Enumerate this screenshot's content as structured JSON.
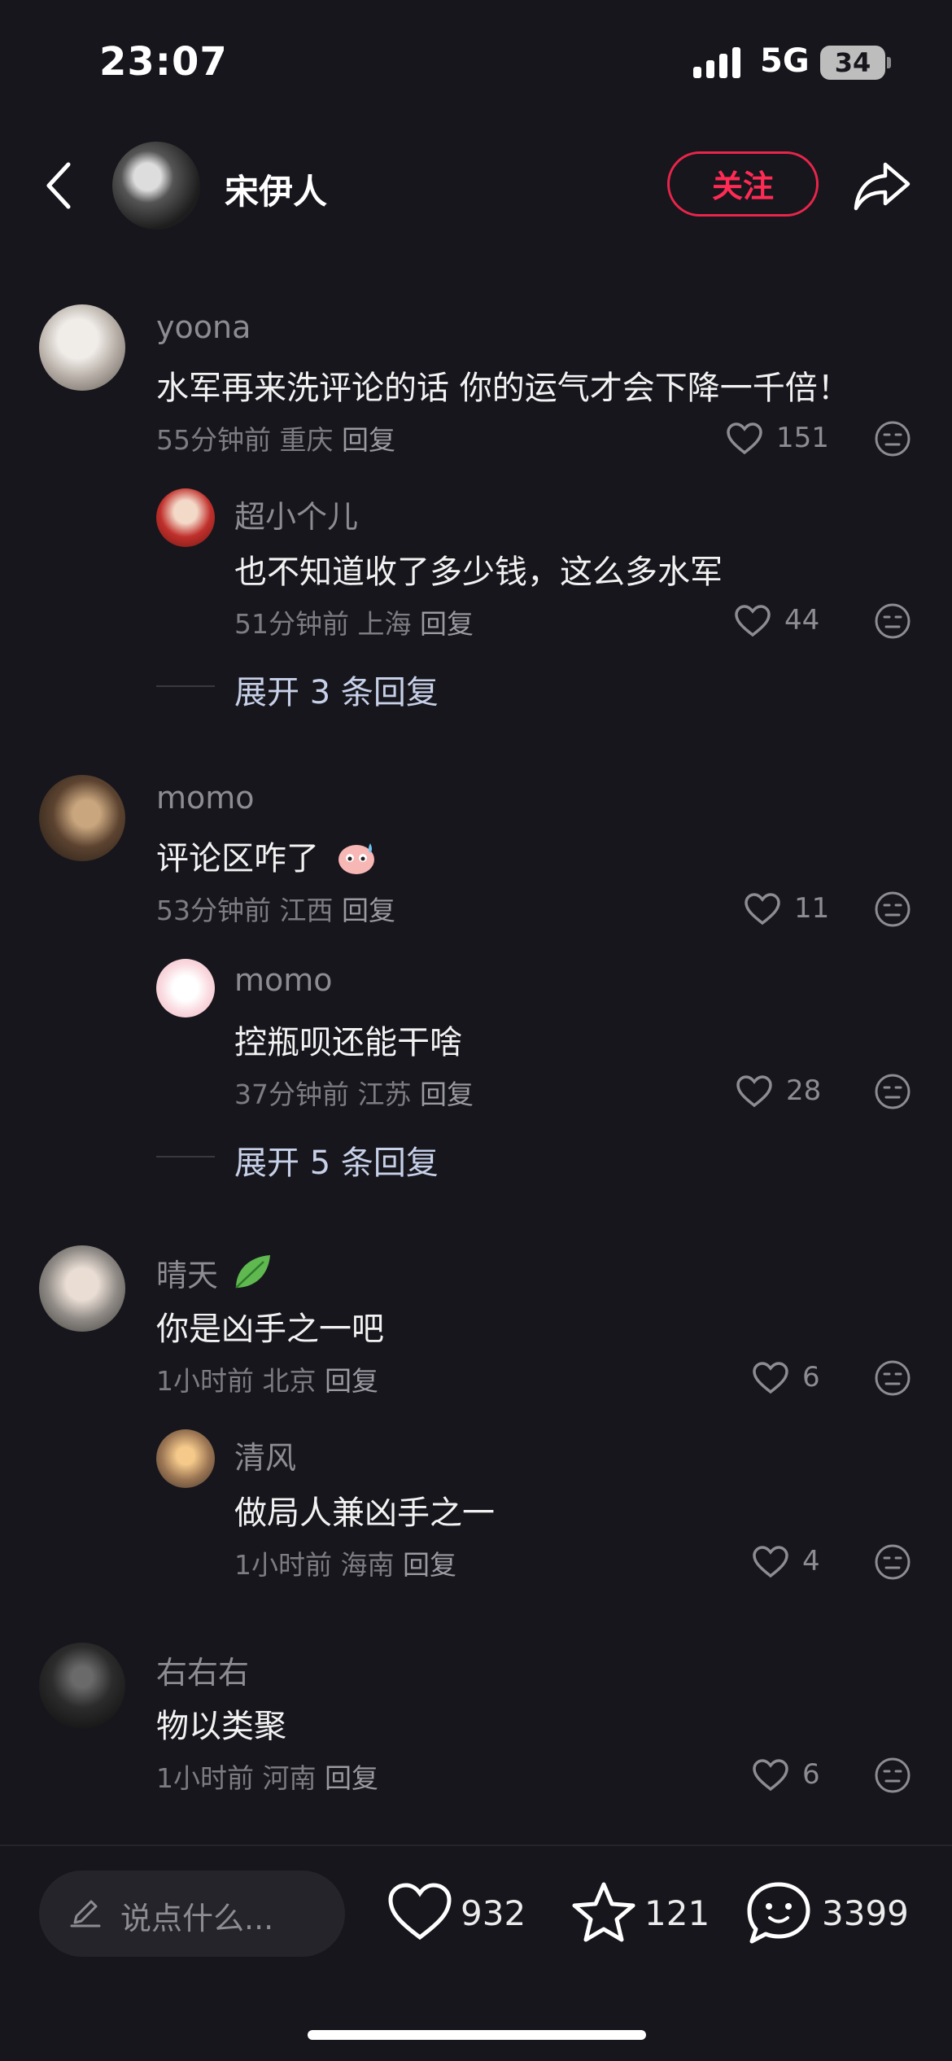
{
  "status_bar": {
    "time": "23:07",
    "network": "5G",
    "battery": "34"
  },
  "header": {
    "host_name": "宋伊人",
    "follow_label": "关注"
  },
  "comments": [
    {
      "user": "yoona",
      "text": "水军再来洗评论的话 你的运气才会下降一千倍！",
      "time": "55分钟前",
      "location": "重庆",
      "reply": "回复",
      "likes": "151",
      "replies": [
        {
          "user": "超小个儿",
          "text": "也不知道收了多少钱，这么多水军",
          "time": "51分钟前",
          "location": "上海",
          "reply": "回复",
          "likes": "44"
        }
      ],
      "expand_label": "展开 3 条回复"
    },
    {
      "user": "momo",
      "text": "评论区咋了",
      "time": "53分钟前",
      "location": "江西",
      "reply": "回复",
      "likes": "11",
      "replies": [
        {
          "user": "momo",
          "text": "控瓶呗还能干啥",
          "time": "37分钟前",
          "location": "江苏",
          "reply": "回复",
          "likes": "28"
        }
      ],
      "expand_label": "展开 5 条回复"
    },
    {
      "user": "晴天",
      "text": "你是凶手之一吧",
      "time": "1小时前",
      "location": "北京",
      "reply": "回复",
      "likes": "6",
      "replies": [
        {
          "user": "清风",
          "text": "做局人兼凶手之一",
          "time": "1小时前",
          "location": "海南",
          "reply": "回复",
          "likes": "4"
        }
      ]
    },
    {
      "user": "右右右",
      "text": "物以类聚",
      "time": "1小时前",
      "location": "河南",
      "reply": "回复",
      "likes": "6"
    }
  ],
  "bottom_bar": {
    "input_placeholder": "说点什么...",
    "likes": "932",
    "favorites": "121",
    "comments": "3399"
  },
  "colors": {
    "background": "#17161c",
    "accent": "#ff2b55",
    "muted": "#8d8c93"
  },
  "icons": [
    "back-icon",
    "share-icon",
    "heart-icon",
    "dislike-face-icon",
    "pencil-icon",
    "star-icon",
    "comment-bubble-icon",
    "leaf-icon",
    "emoji-icon"
  ]
}
